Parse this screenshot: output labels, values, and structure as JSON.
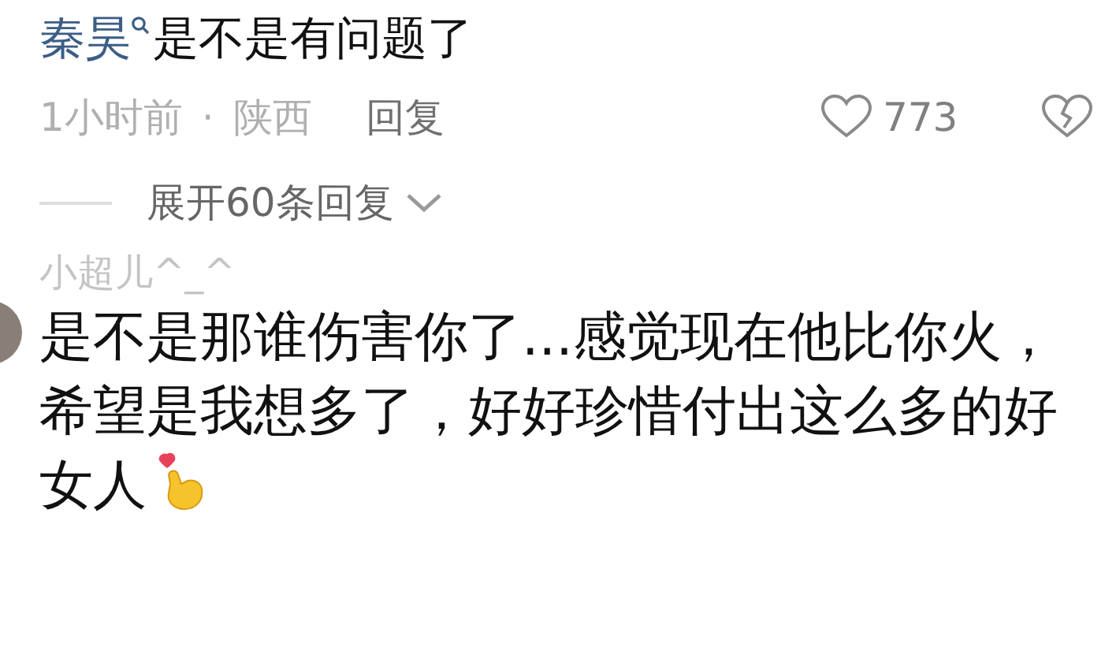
{
  "comments": [
    {
      "user": "秦昊",
      "text": "是不是有问题了",
      "time": "1小时前",
      "separator": "·",
      "location": "陕西",
      "reply_label": "回复",
      "likes": "773"
    },
    {
      "user": "小超儿^_^",
      "text": "是不是那谁伤害你了...感觉现在他比你火，希望是我想多了，好好珍惜付出这么多的好女人"
    }
  ],
  "expand": {
    "label": "展开60条回复"
  }
}
